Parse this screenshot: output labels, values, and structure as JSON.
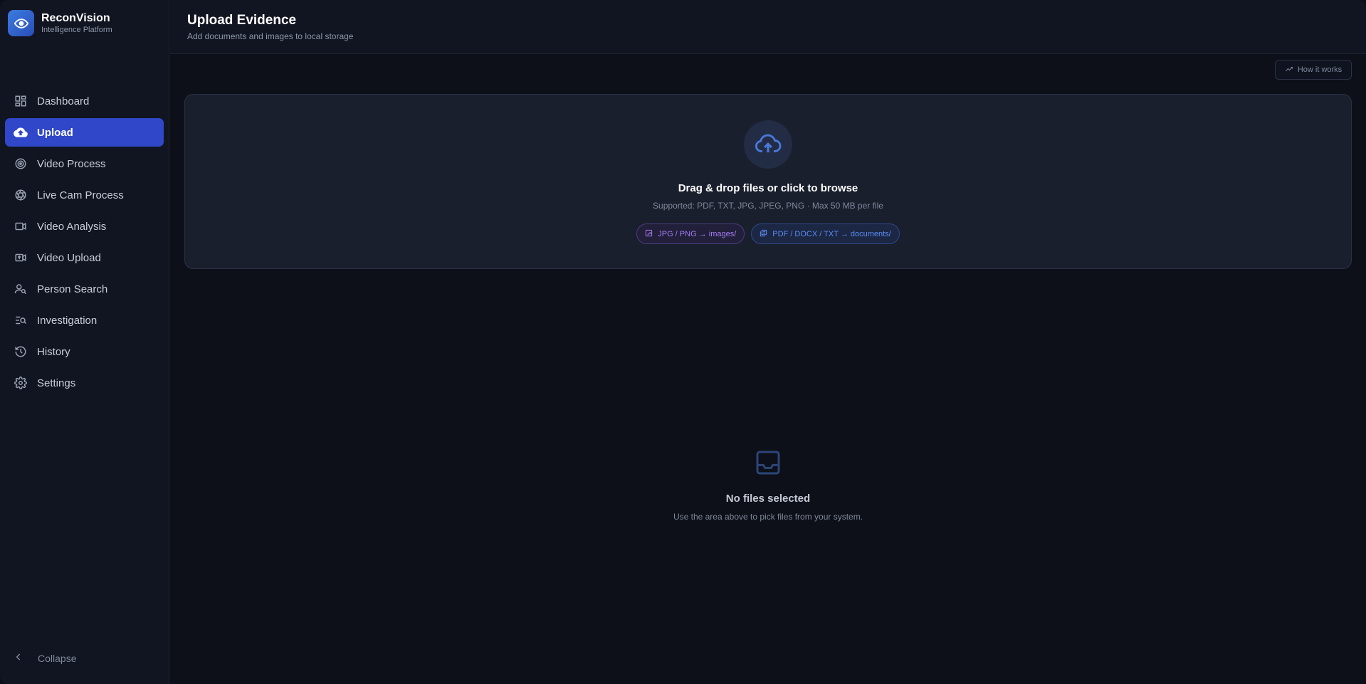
{
  "brand": {
    "name": "ReconVision",
    "subtitle": "Intelligence Platform",
    "icon": "eye-icon",
    "accent": "#2f47c8"
  },
  "sidebar": {
    "items": [
      {
        "label": "Dashboard",
        "icon": "dashboard-icon"
      },
      {
        "label": "Upload",
        "icon": "cloud-upload-icon",
        "active": true
      },
      {
        "label": "Video Process",
        "icon": "target-icon"
      },
      {
        "label": "Live Cam Process",
        "icon": "aperture-icon"
      },
      {
        "label": "Video Analysis",
        "icon": "video-camera-icon"
      },
      {
        "label": "Video Upload",
        "icon": "video-upload-icon"
      },
      {
        "label": "Person Search",
        "icon": "person-search-icon"
      },
      {
        "label": "Investigation",
        "icon": "list-search-icon"
      },
      {
        "label": "History",
        "icon": "history-icon"
      },
      {
        "label": "Settings",
        "icon": "gear-icon"
      }
    ],
    "collapse_label": "Collapse"
  },
  "header": {
    "title": "Upload Evidence",
    "subtitle": "Add documents and images to local storage"
  },
  "toolbar": {
    "how_it_works": "How it works"
  },
  "dropzone": {
    "title": "Drag & drop files or click to browse",
    "supported": "Supported: PDF, TXT, JPG, JPEG, PNG  ·  Max 50 MB per file",
    "chips": [
      {
        "label": "JPG / PNG → images/",
        "icon": "image-icon",
        "color": "#a47cf0"
      },
      {
        "label": "PDF / DOCX / TXT → documents/",
        "icon": "documents-icon",
        "color": "#5b8cf2"
      }
    ]
  },
  "empty_state": {
    "icon": "inbox-icon",
    "title": "No files selected",
    "subtitle": "Use the area above to pick files from your system."
  }
}
